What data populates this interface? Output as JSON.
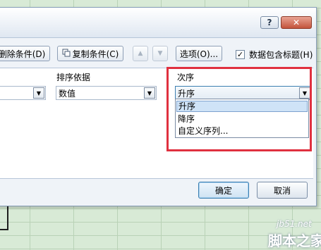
{
  "dialog": {
    "title_buttons": {
      "help": "?",
      "close": "✕"
    },
    "toolbar": {
      "delete_label": "删除条件(D)",
      "copy_label": "复制条件(C)",
      "up_icon": "▲",
      "down_icon": "▼",
      "options_label": "选项(O)...",
      "has_headers_label": "数据包含标题(H)",
      "has_headers_checked": true,
      "check_mark": "✓"
    },
    "columns": {
      "sort_on_header": "排序依据",
      "order_header": "次序"
    },
    "rows": [
      {
        "sort_on": "数值",
        "order": "升序"
      }
    ],
    "order_dropdown": {
      "options": [
        "升序",
        "降序",
        "自定义序列..."
      ],
      "selected_index": 0
    },
    "ok_label": "确定",
    "cancel_label": "取消"
  },
  "watermark": {
    "site": "jb51.net",
    "brand": "脚本之家"
  },
  "colors": {
    "highlight": "#e0303f",
    "accent": "#3c7fb1"
  }
}
